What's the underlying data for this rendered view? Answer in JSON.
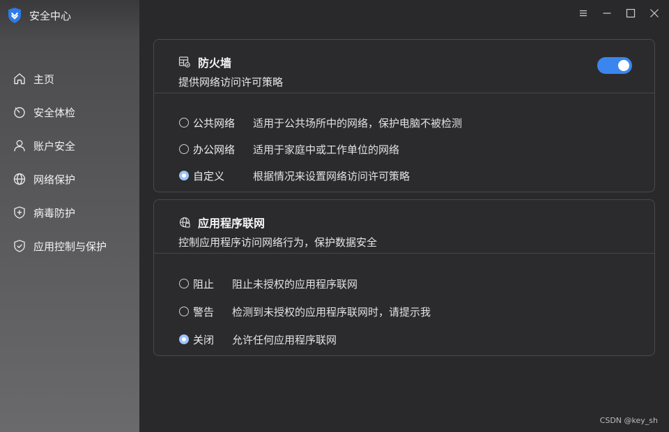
{
  "app": {
    "title": "安全中心"
  },
  "colors": {
    "accent": "#3a86ee",
    "sidebar_bg": "#4c4c4e",
    "main_bg": "#29292b",
    "logo": "#2d7be5"
  },
  "sidebar": {
    "items": [
      {
        "label": "主页",
        "icon": "home-icon"
      },
      {
        "label": "安全体检",
        "icon": "checkup-icon"
      },
      {
        "label": "账户安全",
        "icon": "user-icon"
      },
      {
        "label": "网络保护",
        "icon": "globe-icon"
      },
      {
        "label": "病毒防护",
        "icon": "shield-plus-icon"
      },
      {
        "label": "应用控制与保护",
        "icon": "shield-check-icon"
      }
    ]
  },
  "window_controls": [
    "menu-icon",
    "minimize-icon",
    "maximize-icon",
    "close-icon"
  ],
  "firewall": {
    "title": "防火墙",
    "description": "提供网络访问许可策略",
    "enabled": true,
    "options": [
      {
        "label": "公共网络",
        "desc": "适用于公共场所中的网络，保护电脑不被检测",
        "checked": false
      },
      {
        "label": "办公网络",
        "desc": "适用于家庭中或工作单位的网络",
        "checked": false
      },
      {
        "label": "自定义",
        "desc": "根据情况来设置网络访问许可策略",
        "checked": true
      }
    ]
  },
  "app_network": {
    "title": "应用程序联网",
    "description": "控制应用程序访问网络行为，保护数据安全",
    "options": [
      {
        "label": "阻止",
        "desc": "阻止未授权的应用程序联网",
        "checked": false
      },
      {
        "label": "警告",
        "desc": "检测到未授权的应用程序联网时，请提示我",
        "checked": false
      },
      {
        "label": "关闭",
        "desc": "允许任何应用程序联网",
        "checked": true
      }
    ]
  },
  "watermark": "CSDN @key_sh"
}
